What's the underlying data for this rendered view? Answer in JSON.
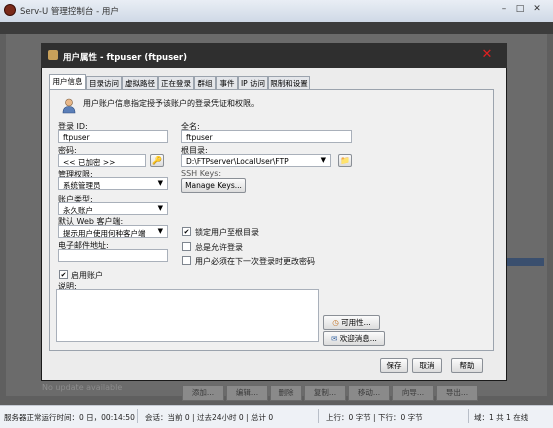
{
  "window": {
    "title": "Serv-U 管理控制台 - 用户"
  },
  "background": {
    "no_update": "No update available",
    "buttons": [
      "添加...",
      "编辑...",
      "删除",
      "复制...",
      "移动...",
      "向导...",
      "导出..."
    ]
  },
  "statusbar": {
    "uptime": "服务器正常运行时间：0 日，00:14:50",
    "sessions": "会话：当前 0 | 过去24小时 0 | 总计 0",
    "transfer": "上行：0 字节 | 下行：0 字节",
    "domains": "域：1 共 1 在线"
  },
  "dialog": {
    "title": "用户属性 - ftpuser (ftpuser)",
    "tabs": [
      "用户信息",
      "目录访问",
      "虚拟路径",
      "正在登录",
      "群组",
      "事件",
      "IP 访问",
      "限制和设置"
    ],
    "info_text": "用户账户信息指定授予该账户的登录凭证和权限。",
    "login_id_label": "登录 ID:",
    "login_id_value": "ftpuser",
    "fullname_label": "全名:",
    "fullname_value": "ftpuser",
    "password_label": "密码:",
    "password_value": "<< 已加密 >>",
    "rootdir_label": "根目录:",
    "rootdir_value": "D:\\FTPserver\\LocalUser\\FTP",
    "admin_label": "管理权限:",
    "admin_value": "系统管理员",
    "ssh_label": "SSH Keys:",
    "manage_keys": "Manage Keys...",
    "account_type_label": "账户类型:",
    "account_type_value": "永久账户",
    "web_client_label": "默认 Web 客户端:",
    "web_client_value": "提示用户使用何种客户端",
    "lock_root": "锁定用户至根目录",
    "always_allow": "总是允许登录",
    "must_change": "用户必须在下一次登录时更改密码",
    "email_label": "电子邮件地址:",
    "email_value": "",
    "enable_account": "启用账户",
    "desc_label": "说明:",
    "available_btn": "可用性...",
    "welcome_btn": "欢迎消息...",
    "save": "保存",
    "cancel": "取消",
    "help": "帮助"
  }
}
